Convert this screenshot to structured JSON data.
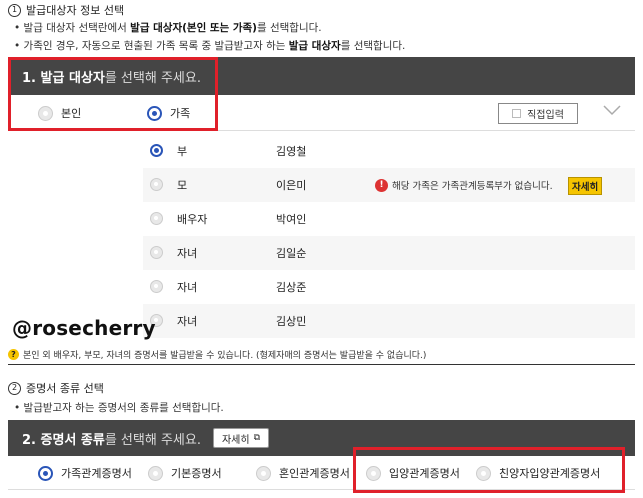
{
  "section1": {
    "step_num": "1",
    "step_title": "발급대상자 정보 선택",
    "bullet1_pre": "• 발급 대상자 선택란에서 ",
    "bullet1_bold": "발급 대상자(본인 또는 가족)",
    "bullet1_post": "를 선택합니다.",
    "bullet2_pre": "• 가족인 경우, 자동으로 현출된 가족 목록 중 발급받고자 하는 ",
    "bullet2_bold": "발급 대상자",
    "bullet2_post": "를 선택합니다.",
    "bar_bold": "1. 발급 대상자",
    "bar_light": "를 선택해 주세요.",
    "radio_self": "본인",
    "radio_family": "가족",
    "direct_input": "직접입력",
    "family": [
      {
        "relation": "부",
        "name": "김영철",
        "selected": true
      },
      {
        "relation": "모",
        "name": "이은미",
        "selected": false,
        "warning": "해당 가족은 가족관계등록부가 없습니다.",
        "detail": "자세히"
      },
      {
        "relation": "배우자",
        "name": "박여인",
        "selected": false
      },
      {
        "relation": "자녀",
        "name": "김일순",
        "selected": false
      },
      {
        "relation": "자녀",
        "name": "김상준",
        "selected": false
      },
      {
        "relation": "자녀",
        "name": "김상민",
        "selected": false
      }
    ],
    "note": "본인 외 배우자, 부모, 자녀의 증명서를 발급받을 수 있습니다. (형제자매의 증명서는 발급받을 수 없습니다.)"
  },
  "watermark": "@rosecherry",
  "section2": {
    "step_num": "2",
    "step_title": "증명서 종류 선택",
    "bullet1": "• 발급받고자 하는 증명서의 종류를 선택합니다.",
    "bar_bold": "2. 증명서 종류",
    "bar_light": "를 선택해 주세요.",
    "detail_btn": "자세히",
    "certs": [
      "가족관계증명서",
      "기본증명서",
      "혼인관계증명서",
      "입양관계증명서",
      "친양자입양관계증명서"
    ]
  },
  "colors": {
    "accent": "#2a55b8",
    "highlight": "#e0202a",
    "bar": "#454545",
    "tag": "#f5c400"
  }
}
